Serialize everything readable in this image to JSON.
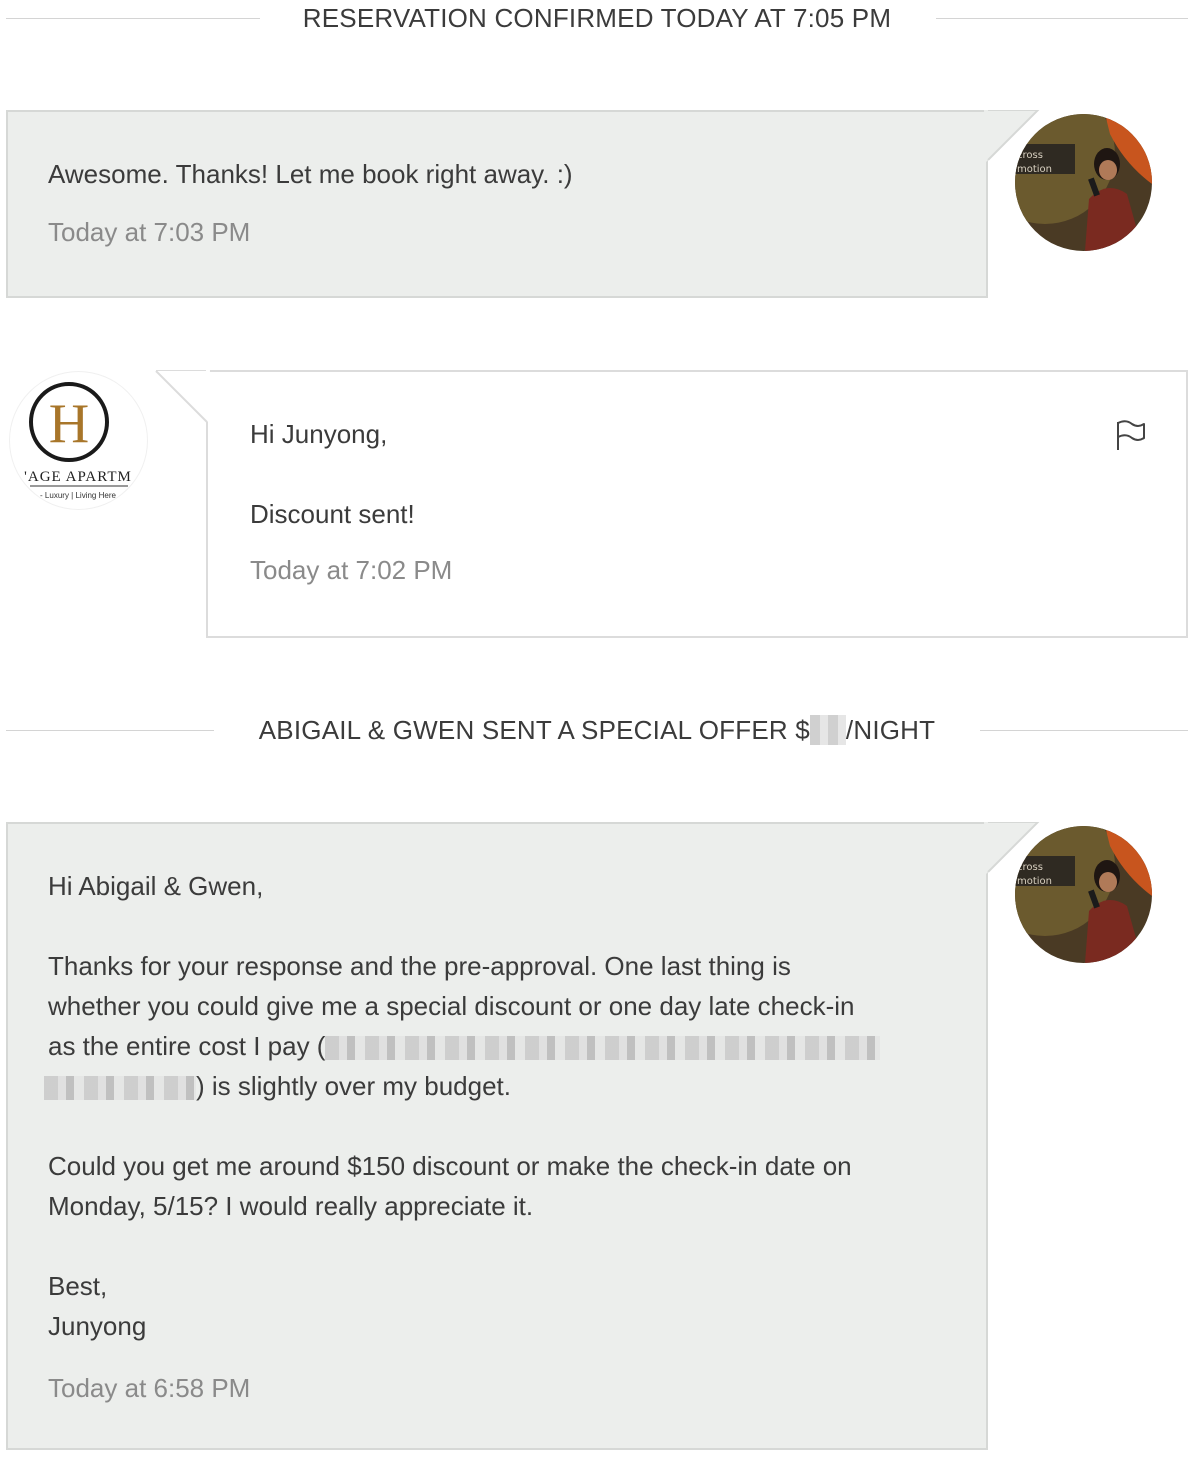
{
  "events": {
    "reservation_confirmed": "RESERVATION CONFIRMED TODAY AT 7:05 PM",
    "special_offer_prefix": "ABIGAIL & GWEN SENT A SPECIAL OFFER $",
    "special_offer_suffix": "/NIGHT"
  },
  "messages": [
    {
      "sender": "guest",
      "lines": [
        "Awesome. Thanks! Let me book right away. :)"
      ],
      "time": "Today at 7:03 PM"
    },
    {
      "sender": "host",
      "greeting": "Hi Junyong,",
      "body": "Discount sent!",
      "time": "Today at 7:02 PM"
    },
    {
      "sender": "guest",
      "greeting": "Hi Abigail & Gwen,",
      "para1_a": "Thanks for your response and the pre-approval. One last thing is",
      "para1_b": "whether you could give me a special discount or one day late check-in",
      "para1_c": "as the entire cost I pay (",
      "para1_d": ") is slightly over my budget.",
      "para2_a": "Could you get me around $150 discount or make the check-in date on",
      "para2_b": "Monday, 5/15? I would really appreciate it.",
      "signoff": "Best,",
      "name": "Junyong",
      "time": "Today at 6:58 PM"
    }
  ],
  "host_logo": {
    "letter": "H",
    "line1": "'AGE APARTM",
    "line2": "- Luxury | Living Here"
  },
  "colors": {
    "guest_bubble": "#eceeec",
    "host_bubble": "#ffffff",
    "logo_gold": "#a8762a"
  },
  "icons": {
    "flag": "flag-icon"
  }
}
